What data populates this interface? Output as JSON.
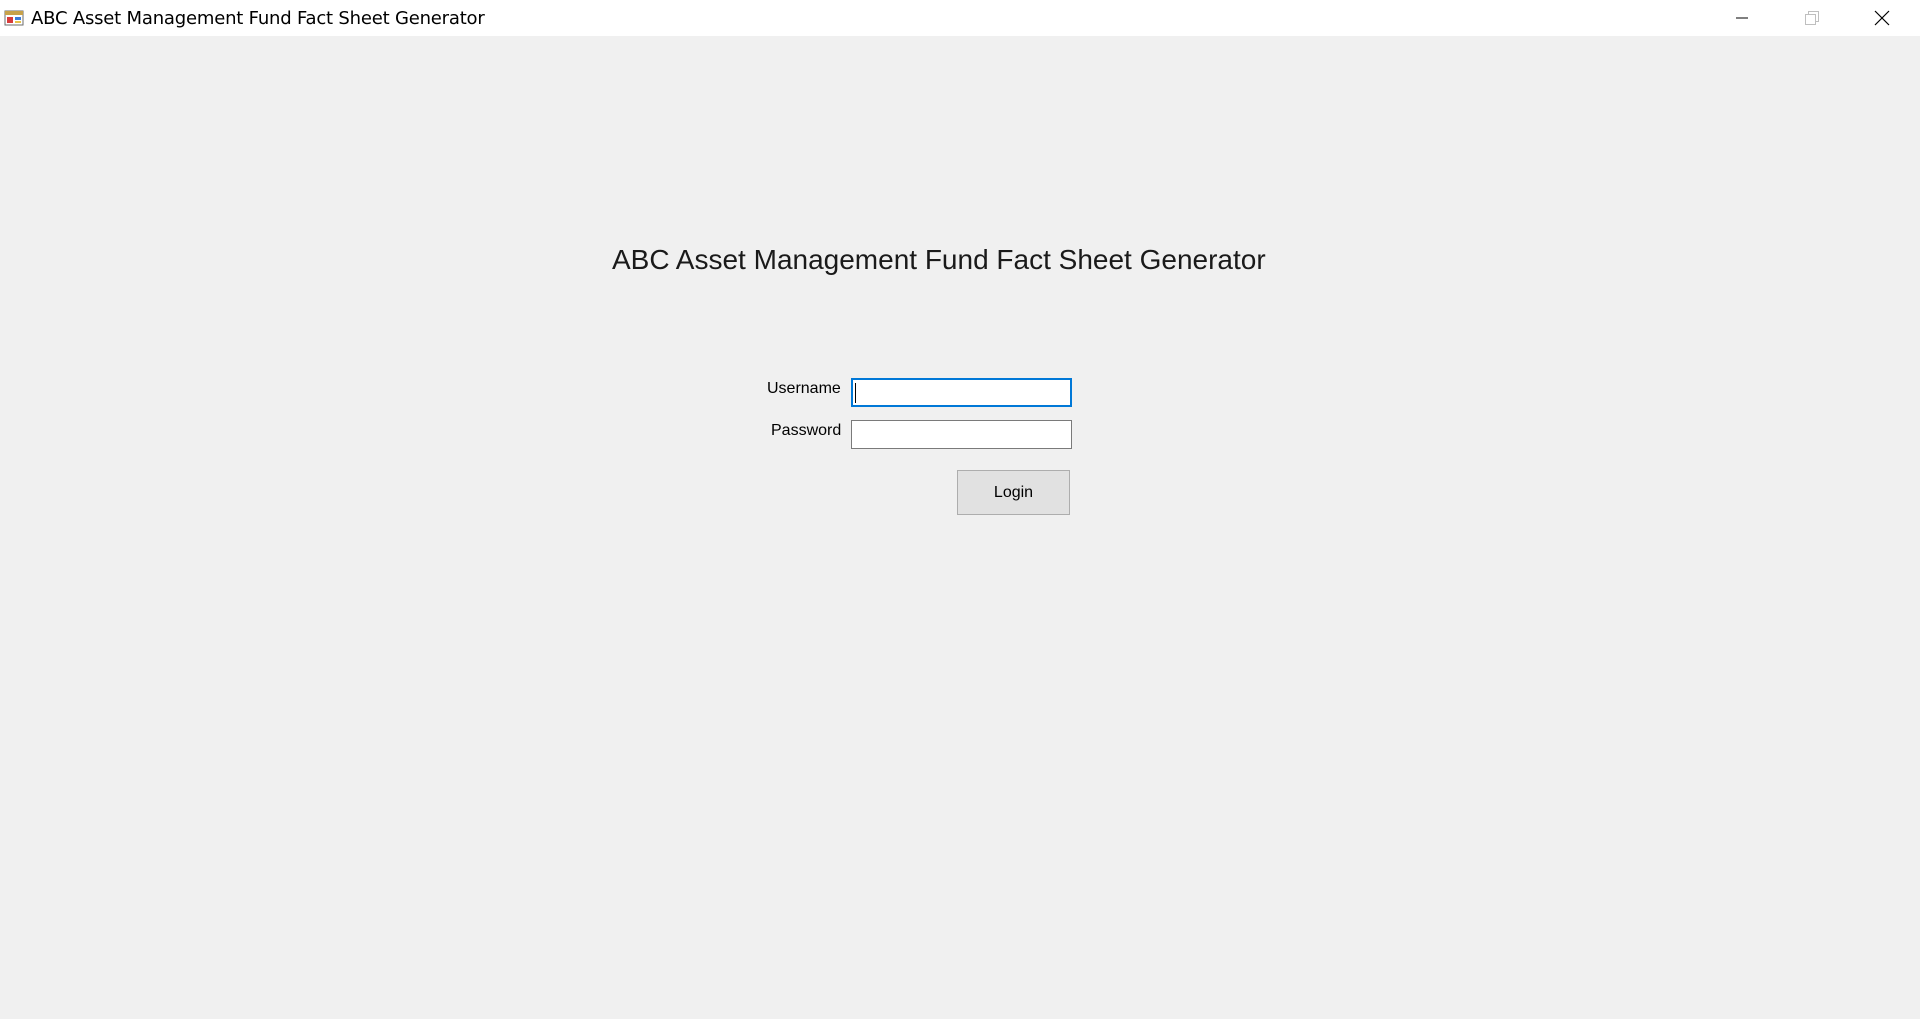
{
  "window": {
    "title": "ABC Asset Management Fund Fact Sheet Generator",
    "app_icon": "winforms-app-icon",
    "controls": {
      "minimize_icon": "minimize-icon",
      "maximize_icon": "restore-icon",
      "close_icon": "close-icon"
    }
  },
  "form": {
    "heading": "ABC Asset Management Fund Fact Sheet Generator",
    "username_label": "Username",
    "username_value": "",
    "password_label": "Password",
    "password_value": "",
    "login_label": "Login"
  },
  "colors": {
    "background": "#f0f0f0",
    "focus_border": "#0078d7",
    "button_face": "#e1e1e1"
  }
}
